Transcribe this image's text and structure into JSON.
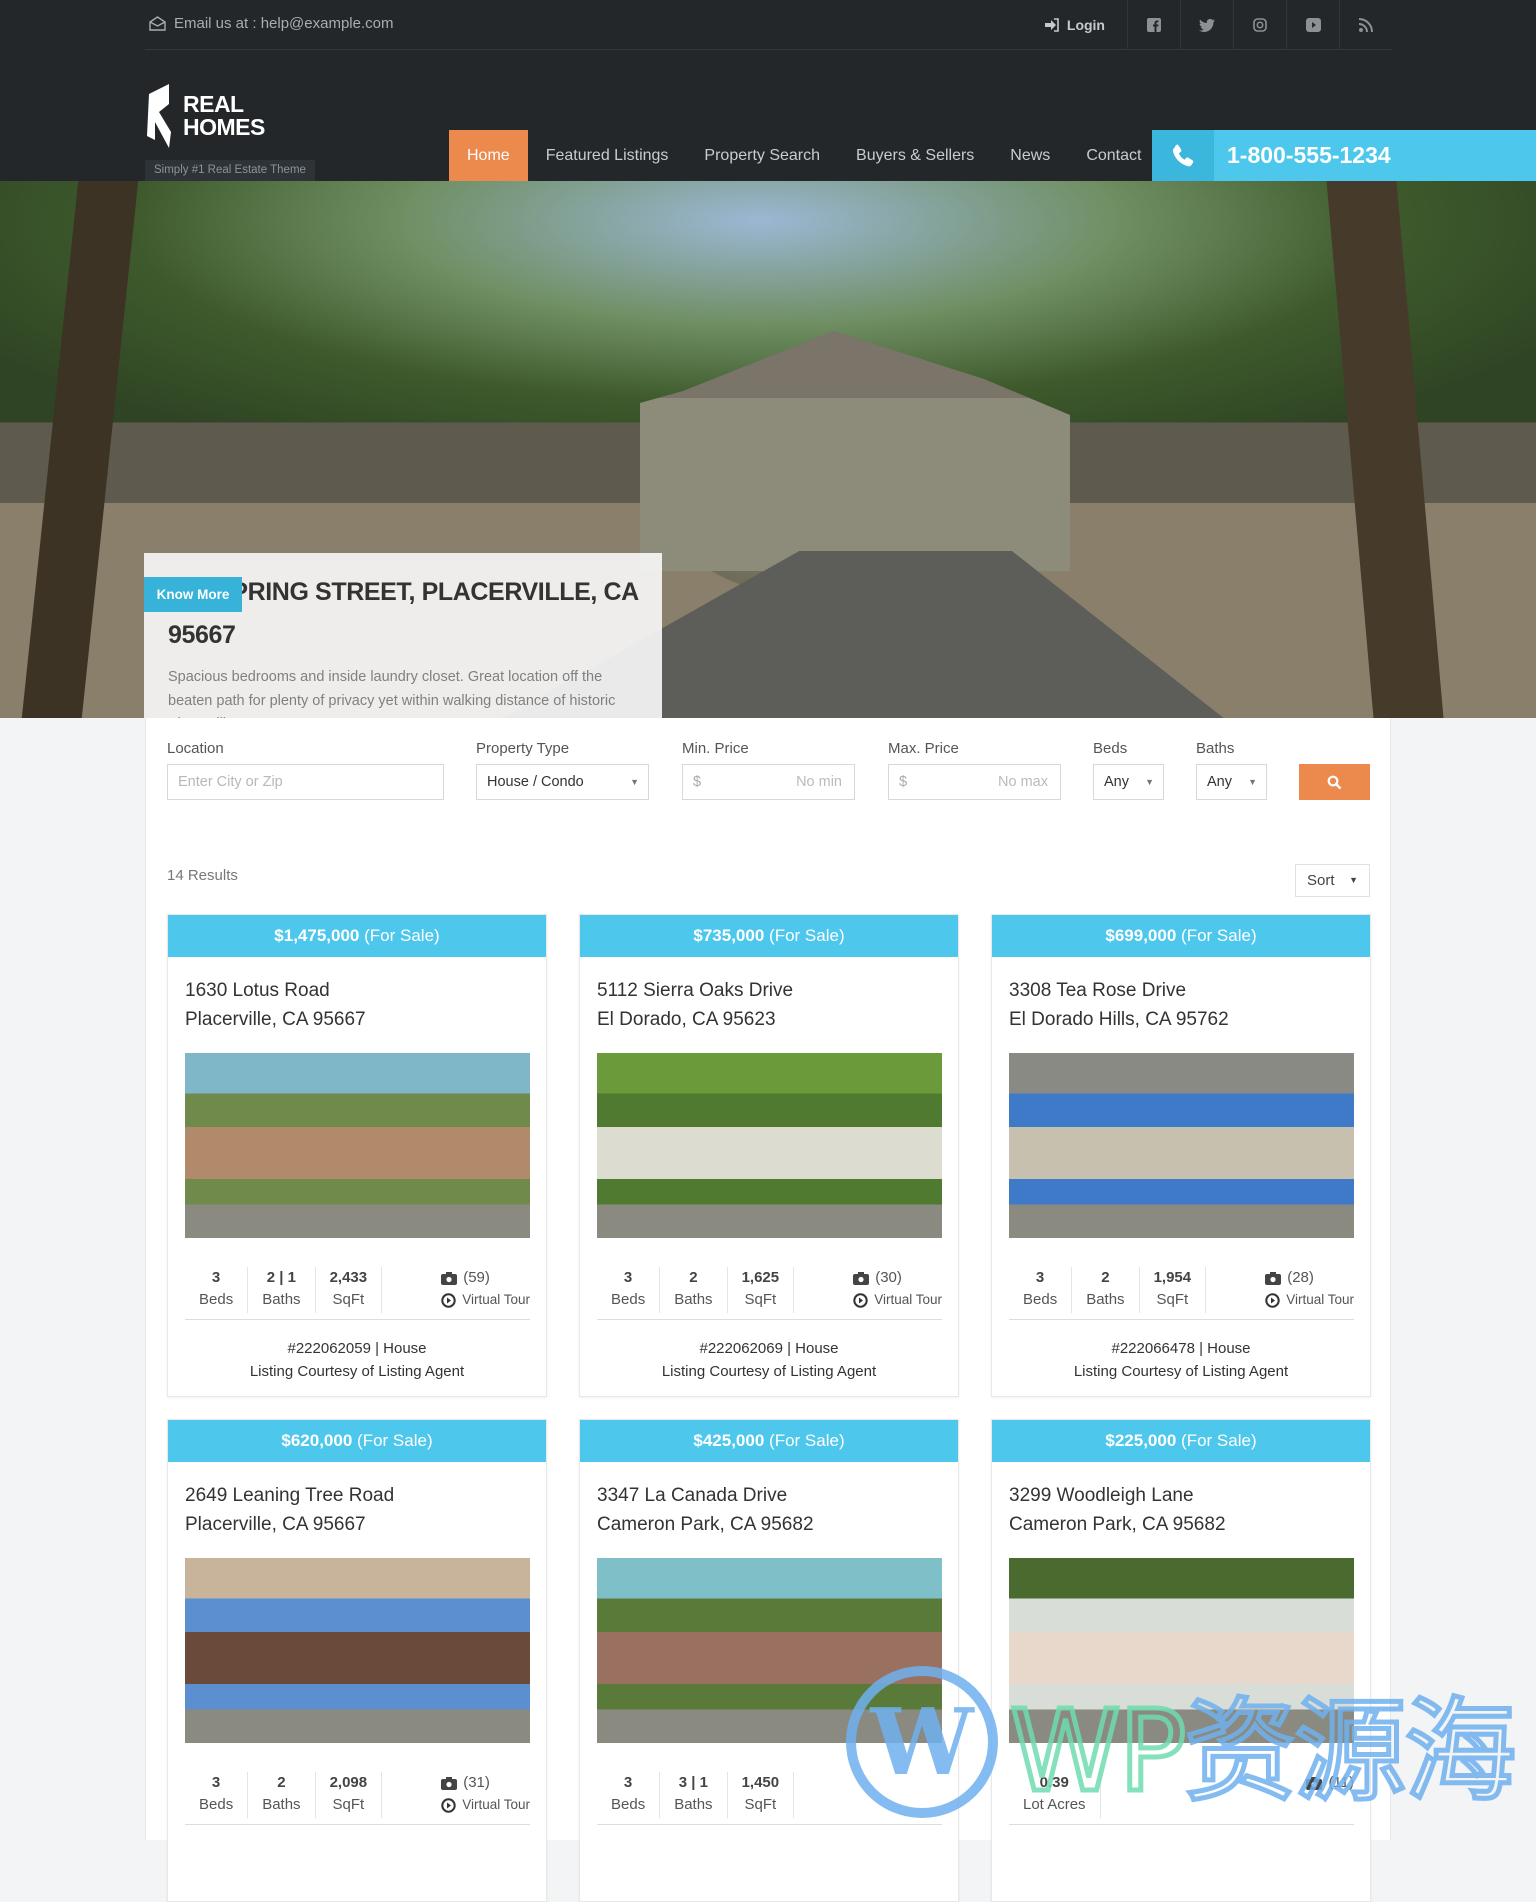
{
  "topbar": {
    "email": "Email us at : help@example.com",
    "login": "Login",
    "social_icons": [
      "facebook-icon",
      "twitter-icon",
      "instagram-icon",
      "youtube-icon",
      "rss-icon"
    ]
  },
  "logo": {
    "line1": "REAL",
    "line2": "HOMES",
    "tagline": "Simply #1 Real Estate Theme"
  },
  "nav": {
    "items": [
      {
        "label": "Home",
        "active": true
      },
      {
        "label": "Featured Listings"
      },
      {
        "label": "Property Search"
      },
      {
        "label": "Buyers & Sellers"
      },
      {
        "label": "News"
      },
      {
        "label": "Contact"
      }
    ]
  },
  "phone": {
    "number": "1-800-555-1234"
  },
  "hero": {
    "title": "790 SPRING STREET, PLACERVILLE, CA 95667",
    "description": "Spacious bedrooms and inside laundry closet. Great location off the beaten path for plenty of privacy yet within walking distance of historic Placerville.",
    "button": "Know More"
  },
  "search": {
    "location_label": "Location",
    "location_placeholder": "Enter City or Zip",
    "type_label": "Property Type",
    "type_value": "House / Condo",
    "min_label": "Min. Price",
    "min_prefix": "$",
    "min_placeholder": "No min",
    "max_label": "Max. Price",
    "max_prefix": "$",
    "max_placeholder": "No max",
    "beds_label": "Beds",
    "beds_value": "Any",
    "baths_label": "Baths",
    "baths_value": "Any"
  },
  "results": {
    "count": "14 Results",
    "sort": "Sort"
  },
  "listings": [
    {
      "price": "$1,475,000",
      "status": "(For Sale)",
      "addr1": "1630 Lotus Road",
      "addr2": "Placerville, CA 95667",
      "stats": [
        {
          "v": "3",
          "l": "Beds"
        },
        {
          "v": "2 | 1",
          "l": "Baths"
        },
        {
          "v": "2,433",
          "l": "SqFt"
        }
      ],
      "photos": "(59)",
      "tour": "Virtual Tour",
      "id": "#222062059 | House",
      "courtesy": "Listing Courtesy of Listing Agent",
      "palette": [
        "#6f8a4a",
        "#b08a6a",
        "#7fb7c8"
      ]
    },
    {
      "price": "$735,000",
      "status": "(For Sale)",
      "addr1": "5112 Sierra Oaks Drive",
      "addr2": "El Dorado, CA 95623",
      "stats": [
        {
          "v": "3",
          "l": "Beds"
        },
        {
          "v": "2",
          "l": "Baths"
        },
        {
          "v": "1,625",
          "l": "SqFt"
        }
      ],
      "photos": "(30)",
      "tour": "Virtual Tour",
      "id": "#222062069 | House",
      "courtesy": "Listing Courtesy of Listing Agent",
      "palette": [
        "#4f7a30",
        "#dcdcd0",
        "#6a9a3a"
      ]
    },
    {
      "price": "$699,000",
      "status": "(For Sale)",
      "addr1": "3308 Tea Rose Drive",
      "addr2": "El Dorado Hills, CA 95762",
      "stats": [
        {
          "v": "3",
          "l": "Beds"
        },
        {
          "v": "2",
          "l": "Baths"
        },
        {
          "v": "1,954",
          "l": "SqFt"
        }
      ],
      "photos": "(28)",
      "tour": "Virtual Tour",
      "id": "#222066478 | House",
      "courtesy": "Listing Courtesy of Listing Agent",
      "palette": [
        "#3f7ac8",
        "#c8c0ae",
        "#8a8a84"
      ]
    },
    {
      "price": "$620,000",
      "status": "(For Sale)",
      "addr1": "2649 Leaning Tree Road",
      "addr2": "Placerville, CA 95667",
      "stats": [
        {
          "v": "3",
          "l": "Beds"
        },
        {
          "v": "2",
          "l": "Baths"
        },
        {
          "v": "2,098",
          "l": "SqFt"
        }
      ],
      "photos": "(31)",
      "tour": "Virtual Tour",
      "palette": [
        "#5b8fd0",
        "#6a4a38",
        "#c8b49a"
      ]
    },
    {
      "price": "$425,000",
      "status": "(For Sale)",
      "addr1": "3347 La Canada Drive",
      "addr2": "Cameron Park, CA 95682",
      "stats": [
        {
          "v": "3",
          "l": "Beds"
        },
        {
          "v": "3 | 1",
          "l": "Baths"
        },
        {
          "v": "1,450",
          "l": "SqFt"
        }
      ],
      "palette": [
        "#5a7a3a",
        "#9a7060",
        "#7fc0c8"
      ]
    },
    {
      "price": "$225,000",
      "status": "(For Sale)",
      "addr1": "3299 Woodleigh Lane",
      "addr2": "Cameron Park, CA 95682",
      "stats": [
        {
          "v": "0.39",
          "l": "Lot Acres"
        }
      ],
      "photos": "(11)",
      "palette": [
        "#d8ddd8",
        "#e8d8cc",
        "#4a6a30"
      ]
    }
  ],
  "watermark": {
    "text": "WP资源海"
  },
  "colors": {
    "accent_orange": "#ec894d",
    "accent_blue": "#4dc7ec",
    "header_bg": "#23272a"
  }
}
